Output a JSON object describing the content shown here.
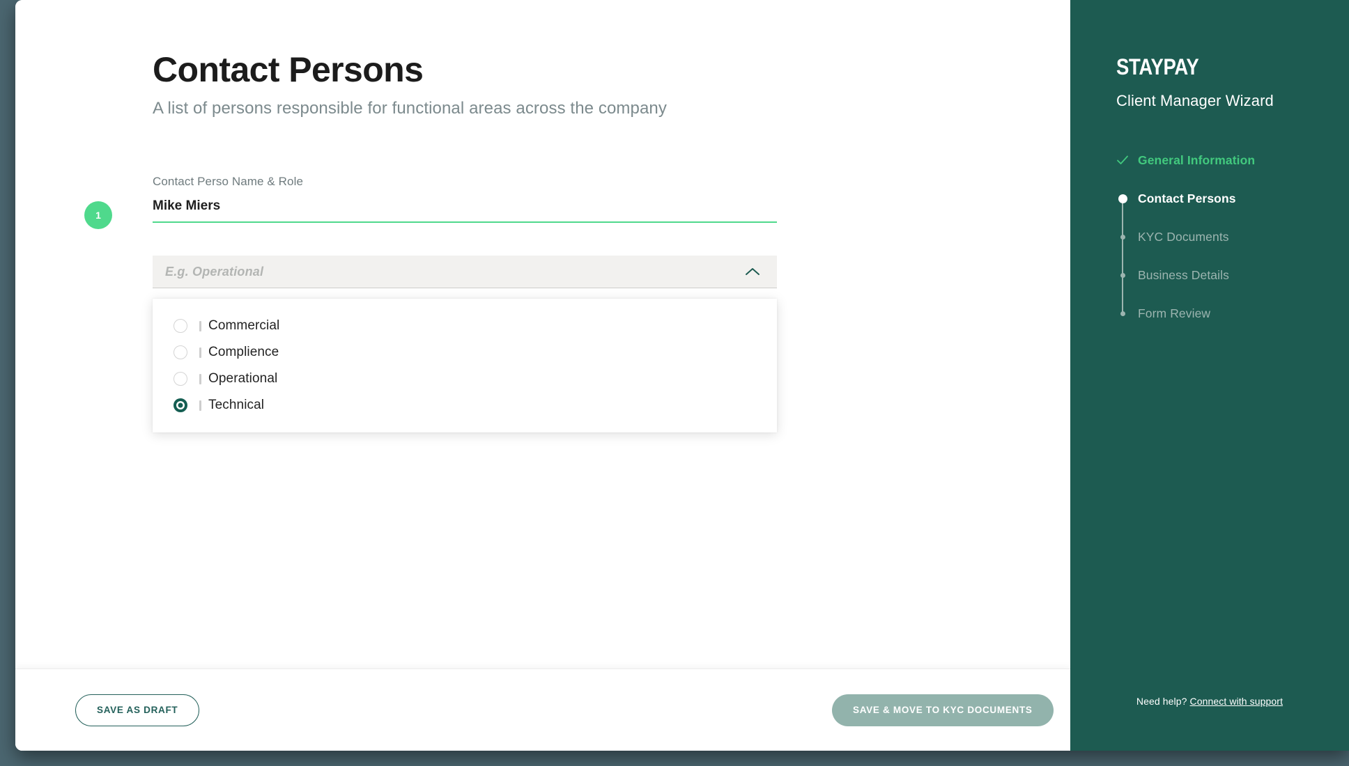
{
  "window": {
    "background_color": "#4b6670",
    "card_color": "#ffffff"
  },
  "main": {
    "title": "Contact Persons",
    "subtitle": "A list of persons responsible for functional areas across the company",
    "entry": {
      "badge_number": "1",
      "name_field": {
        "label": "Contact Perso Name & Role",
        "value": "Mike Miers",
        "placeholder": "Contact Perso Name & Role",
        "underline_color": "#4fd98c"
      },
      "role_select": {
        "placeholder": "E.g. Operational",
        "value": "",
        "expanded": true,
        "chevron_icon": "chevron-up-icon",
        "options": [
          {
            "label": "Commercial",
            "selected": false
          },
          {
            "label": "Complience",
            "selected": false
          },
          {
            "label": "Operational",
            "selected": false
          },
          {
            "label": "Technical",
            "selected": true
          }
        ]
      }
    }
  },
  "footer": {
    "save_draft_label": "SAVE AS DRAFT",
    "next_label": "SAVE & MOVE TO KYC DOCUMENTS",
    "next_enabled": false,
    "next_color": "#92b3ac",
    "draft_border_color": "#23605a"
  },
  "sidebar": {
    "background_color": "#1d5b51",
    "brand": "STAYPAY",
    "brand_subtitle": "Client Manager Wizard",
    "accent_done_color": "#42c97e",
    "steps": [
      {
        "label": "General Information",
        "state": "done",
        "marker": "check-icon"
      },
      {
        "label": "Contact Persons",
        "state": "active",
        "marker": "dot-large"
      },
      {
        "label": "KYC Documents",
        "state": "todo",
        "marker": "dot-small"
      },
      {
        "label": "Business Details",
        "state": "todo",
        "marker": "dot-small"
      },
      {
        "label": "Form Review",
        "state": "todo",
        "marker": "dot-small"
      }
    ],
    "support": {
      "prefix": "Need help?",
      "link_label": "Connect with support"
    }
  }
}
